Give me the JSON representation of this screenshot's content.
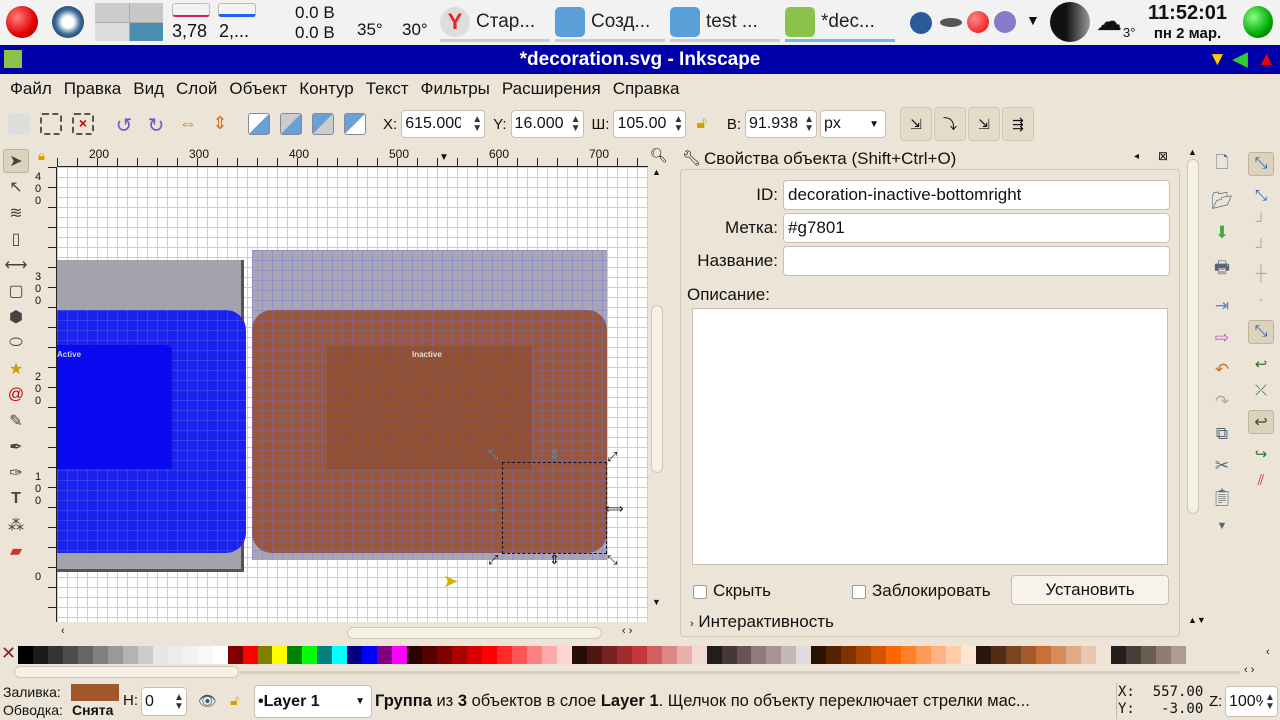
{
  "taskbar": {
    "net_up": "3,78",
    "net_down": "2,...",
    "volt1": "0.0 B",
    "volt2": "0.0 B",
    "temp1": "35°",
    "temp2": "30°",
    "tasks": [
      {
        "label": "Стар...",
        "icon": "yandex-browser-icon"
      },
      {
        "label": "Созд...",
        "icon": "editor-icon"
      },
      {
        "label": "test ...",
        "icon": "file-manager-icon"
      },
      {
        "label": "*dec...",
        "icon": "inkscape-icon"
      }
    ],
    "weather_temp": "3°",
    "clock_time": "11:52:01",
    "clock_date": "пн 2 мар."
  },
  "window": {
    "title": "*decoration.svg - Inkscape"
  },
  "menu": [
    "Файл",
    "Правка",
    "Вид",
    "Слой",
    "Объект",
    "Контур",
    "Текст",
    "Фильтры",
    "Расширения",
    "Справка"
  ],
  "toolbar": {
    "x_label": "X:",
    "x": "615.000",
    "y_label": "Y:",
    "y": "16.000",
    "w_label": "Ш:",
    "w": "105.000",
    "h_label": "В:",
    "h": "91.938",
    "unit": "px"
  },
  "rulers": {
    "h": [
      "200",
      "300",
      "400",
      "500",
      "600",
      "700"
    ],
    "v": [
      "4\n0\n0",
      "3\n0\n0",
      "2\n0\n0",
      "1\n0\n0",
      "0"
    ]
  },
  "canvas": {
    "active_label": "Active",
    "inactive_label": "Inactive"
  },
  "panel": {
    "title": "Свойства объекта (Shift+Ctrl+O)",
    "id_label": "ID:",
    "id": "decoration-inactive-bottomright",
    "label_label": "Метка:",
    "label": "#g7801",
    "name_label": "Название:",
    "name": "",
    "desc_label": "Описание:",
    "desc": "",
    "hide_label": "Скрыть",
    "lock_label": "Заблокировать",
    "set_button": "Установить",
    "interactivity": "Интерактивность"
  },
  "palette": [
    "#000000",
    "#1a1a1a",
    "#333333",
    "#4d4d4d",
    "#666666",
    "#808080",
    "#999999",
    "#b3b3b3",
    "#cccccc",
    "#e6e6e6",
    "#ececec",
    "#f2f2f2",
    "#f8f8f8",
    "#ffffff",
    "#800000",
    "#ff0000",
    "#808000",
    "#ffff00",
    "#008000",
    "#00ff00",
    "#008080",
    "#00ffff",
    "#000080",
    "#0000ff",
    "#800080",
    "#ff00ff",
    "#2b0000",
    "#550000",
    "#800000",
    "#aa0000",
    "#d40000",
    "#ff0000",
    "#ff2a2a",
    "#ff5555",
    "#ff8080",
    "#ffaaaa",
    "#ffd5d5",
    "#280b0b",
    "#501616",
    "#782121",
    "#a02c2c",
    "#c83737",
    "#d35f5f",
    "#de8787",
    "#e9afaf",
    "#f4d7d7",
    "#241c1c",
    "#483737",
    "#6c5353",
    "#917c7c",
    "#ac9393",
    "#c8b7b7",
    "#e3dbdb",
    "#2b1100",
    "#552200",
    "#803300",
    "#aa4400",
    "#d45500",
    "#ff6600",
    "#ff7f2a",
    "#ff9955",
    "#ffb380",
    "#ffccaa",
    "#ffe6d5",
    "#28170b",
    "#502d16",
    "#784421",
    "#a05a2c",
    "#c87137",
    "#d38d5f",
    "#deaa87",
    "#e9c6af",
    "#f4e3d7",
    "#241f1c",
    "#483e37",
    "#6c5d53",
    "#917c6f",
    "#ac9d93"
  ],
  "status": {
    "fill_label": "Заливка:",
    "fill_color": "#a0572c",
    "stroke_label": "Обводка:",
    "stroke_value": "Снята",
    "opacity_label": "Н:",
    "opacity": "0",
    "layer": "•Layer 1",
    "msg_b1": "Группа",
    "msg_t1": " из ",
    "msg_b2": "3",
    "msg_t2": " объектов в слое ",
    "msg_b3": "Layer 1",
    "msg_t3": ". Щелчок по объекту переключает стрелки мас...",
    "x_label": "X:",
    "x": "557.00",
    "y_label": "Y:",
    "y": "-3.00",
    "z_label": "Z:",
    "zoom": "100%"
  }
}
